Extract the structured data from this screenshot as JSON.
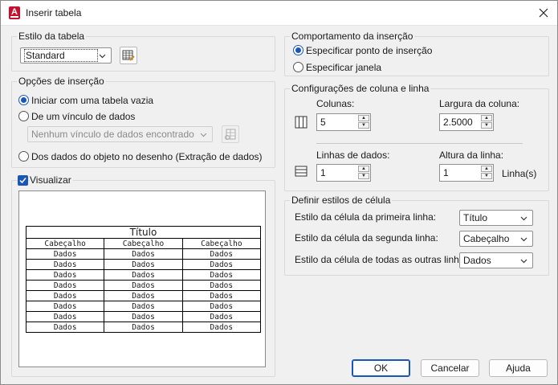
{
  "window": {
    "title": "Inserir tabela",
    "app_icon_letter": "A"
  },
  "table_style": {
    "group_title": "Estilo da tabela",
    "selected": "Standard"
  },
  "insert_options": {
    "group_title": "Opções de inserção",
    "empty_table": "Iniciar com uma tabela vazia",
    "data_link": "De um vínculo de dados",
    "data_link_combo": "Nenhum vínculo de dados encontrado",
    "from_drawing": "Dos dados do objeto no desenho (Extração de dados)"
  },
  "preview": {
    "checkbox_label": "Visualizar",
    "table": {
      "title": "Título",
      "headers": [
        "Cabeçalho",
        "Cabeçalho",
        "Cabeçalho"
      ],
      "rows": [
        [
          "Dados",
          "Dados",
          "Dados"
        ],
        [
          "Dados",
          "Dados",
          "Dados"
        ],
        [
          "Dados",
          "Dados",
          "Dados"
        ],
        [
          "Dados",
          "Dados",
          "Dados"
        ],
        [
          "Dados",
          "Dados",
          "Dados"
        ],
        [
          "Dados",
          "Dados",
          "Dados"
        ],
        [
          "Dados",
          "Dados",
          "Dados"
        ],
        [
          "Dados",
          "Dados",
          "Dados"
        ]
      ]
    }
  },
  "insertion_behavior": {
    "group_title": "Comportamento da inserção",
    "specify_point": "Especificar ponto de inserção",
    "specify_window": "Especificar janela"
  },
  "column_row": {
    "group_title": "Configurações de coluna e linha",
    "columns_label": "Colunas:",
    "columns_value": "5",
    "col_width_label": "Largura da coluna:",
    "col_width_value": "2.5000",
    "data_rows_label": "Linhas de dados:",
    "data_rows_value": "1",
    "row_height_label": "Altura da linha:",
    "row_height_value": "1",
    "row_height_unit": "Linha(s)"
  },
  "cell_styles": {
    "group_title": "Definir estilos de célula",
    "first_row_label": "Estilo da célula da primeira linha:",
    "first_row_value": "Título",
    "second_row_label": "Estilo da célula da segunda linha:",
    "second_row_value": "Cabeçalho",
    "other_rows_label": "Estilo da célula de todas as outras linhas:",
    "other_rows_value": "Dados"
  },
  "buttons": {
    "ok": "OK",
    "cancel": "Cancelar",
    "help": "Ajuda"
  },
  "colors": {
    "accent": "#1a56b7",
    "app_icon": "#c8102e"
  }
}
